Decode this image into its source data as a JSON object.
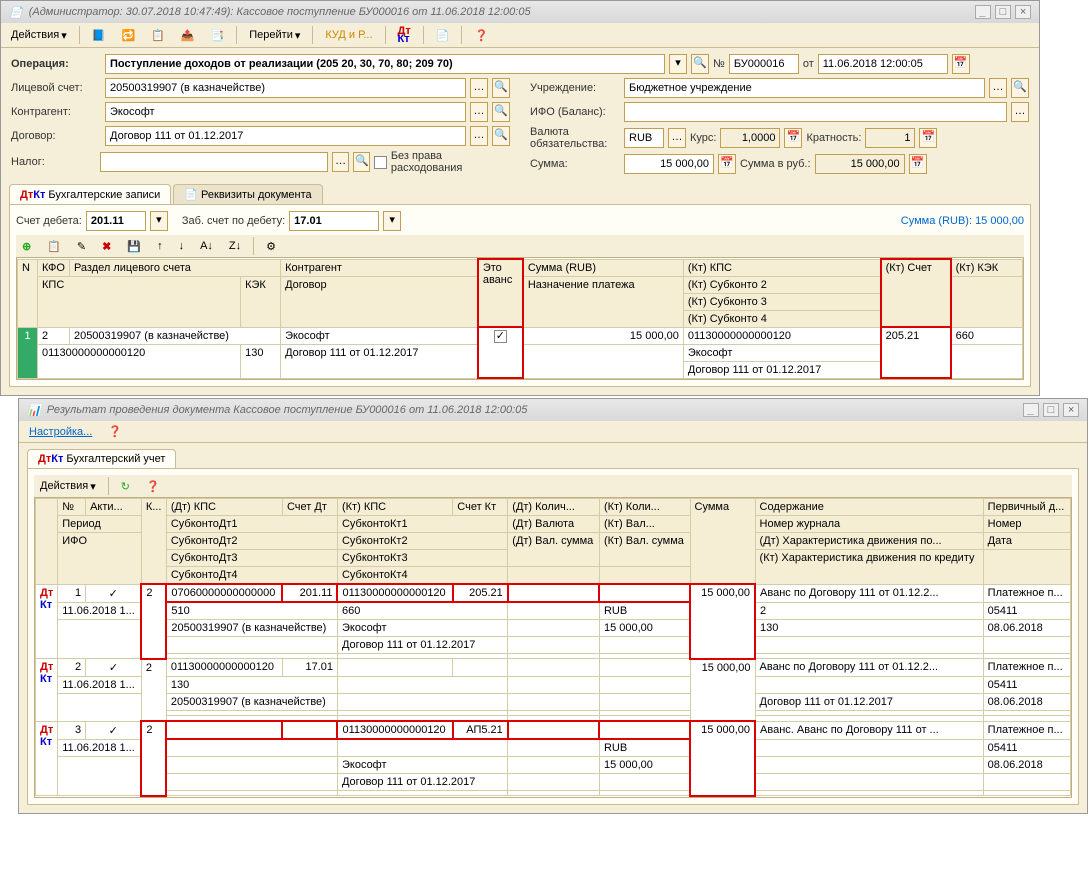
{
  "win1": {
    "title": "(Администратор: 30.07.2018 10:47:49): Кассовое поступление БУ000016 от 11.06.2018 12:00:05",
    "toolbar": {
      "actions": "Действия",
      "goto": "Перейти",
      "kudir": "КУД и Р..."
    },
    "form": {
      "op_label": "Операция:",
      "op_value": "Поступление доходов от реализации (205 20, 30, 70, 80; 209 70)",
      "num_prefix": "№",
      "num": "БУ000016",
      "date_prefix": "от",
      "date": "11.06.2018 12:00:05",
      "ls_label": "Лицевой счет:",
      "ls_value": "20500319907 (в казначействе)",
      "uchr_label": "Учреждение:",
      "uchr_value": "Бюджетное учреждение",
      "kontr_label": "Контрагент:",
      "kontr_value": "Экософт",
      "ifo_label": "ИФО (Баланс):",
      "dog_label": "Договор:",
      "dog_value": "Договор 111 от 01.12.2017",
      "val_label": "Валюта обязательства:",
      "val_value": "RUB",
      "kurs_label": "Курс:",
      "kurs_value": "1,0000",
      "krat_label": "Кратность:",
      "krat_value": "1",
      "nalog_label": "Налог:",
      "bez_prava": "Без права расходования",
      "summa_label": "Сумма:",
      "summa_value": "15 000,00",
      "summa_rub_label": "Сумма в руб.:",
      "summa_rub_value": "15 000,00"
    },
    "tabs": {
      "t1": "Бухгалтерские записи",
      "t2": "Реквизиты документа"
    },
    "grid_top": {
      "schet_debeta_label": "Счет дебета:",
      "schet_debeta": "201.11",
      "zab_label": "Заб. счет по дебету:",
      "zab_value": "17.01",
      "summa_rub_label": "Сумма (RUB): 15 000,00"
    },
    "headers": {
      "n": "N",
      "kfo": "КФО",
      "razdel": "Раздел лицевого счета",
      "kontragent": "Контрагент",
      "eto_avans": "Это аванс",
      "summa": "Сумма (RUB)",
      "kt_kps": "(Кт) КПС",
      "kt_schet": "(Кт) Счет",
      "kt_kek": "(Кт) КЭК",
      "kps": "КПС",
      "kek": "КЭК",
      "dogovor": "Договор",
      "nazn": "Назначение платежа",
      "kt_sub2": "(Кт) Субконто 2",
      "kt_sub3": "(Кт) Субконто 3",
      "kt_sub4": "(Кт) Субконто 4"
    },
    "row": {
      "n": "1",
      "kfo": "2",
      "razdel": "20500319907 (в казначействе)",
      "kontr": "Экософт",
      "avans_check": "✓",
      "summa": "15 000,00",
      "kt_kps": "01130000000000120",
      "kt_schet": "205.21",
      "kt_kek": "660",
      "kps": "01130000000000120",
      "kek": "130",
      "dogovor": "Договор 111 от 01.12.2017",
      "sub2": "Экософт",
      "sub3": "Договор 111 от 01.12.2017"
    }
  },
  "win2": {
    "title": "Результат проведения документа Кассовое поступление БУ000016 от 11.06.2018 12:00:05",
    "settings": "Настройка...",
    "tab1": "Бухгалтерский учет",
    "actions": "Действия",
    "headers": {
      "n": "№",
      "akti": "Акти...",
      "k": "К...",
      "dt_kps": "(Дт) КПС",
      "schet_dt": "Счет Дт",
      "kt_kps": "(Кт) КПС",
      "schet_kt": "Счет Кт",
      "dt_kolich": "(Дт) Колич...",
      "kt_kolich": "(Кт) Коли...",
      "summa": "Сумма",
      "soderzhanie": "Содержание",
      "perv": "Первичный д...",
      "period": "Период",
      "sub_dt1": "СубконтоДт1",
      "sub_kt1": "СубконтоКт1",
      "dt_val": "(Дт) Валюта",
      "kt_val": "(Кт) Вал...",
      "nomer_zh": "Номер журнала",
      "nomer": "Номер",
      "ifo": "ИФО",
      "sub_dt2": "СубконтоДт2",
      "sub_kt2": "СубконтоКт2",
      "dt_val_sum": "(Дт) Вал. сумма",
      "kt_val_sum": "(Кт) Вал. сумма",
      "dt_har": "(Дт) Характеристика движения по...",
      "data": "Дата",
      "sub_dt3": "СубконтоДт3",
      "sub_kt3": "СубконтоКт3",
      "kt_har": "(Кт) Характеристика движения по кредиту",
      "sub_dt4": "СубконтоДт4",
      "sub_kt4": "СубконтоКт4"
    },
    "rows": [
      {
        "n": "1",
        "k": "2",
        "dt_kps": "07060000000000000",
        "schet_dt": "201.11",
        "kt_kps": "01130000000000120",
        "schet_kt": "205.21",
        "summa": "15 000,00",
        "soderzh": "Аванс по Договору 111 от 01.12.2...",
        "perv": "Платежное п...",
        "period": "11.06.2018 1...",
        "sub_dt1": "510",
        "sub_kt1": "660",
        "kt_val": "RUB",
        "nomer_zh": "2",
        "nomer": "05411",
        "sub_dt2": "20500319907 (в казначействе)",
        "sub_kt2": "Экософт",
        "kt_val_sum": "15 000,00",
        "dt_har": "130",
        "data": "08.06.2018",
        "sub_kt3": "Договор 111 от 01.12.2017"
      },
      {
        "n": "2",
        "k": "2",
        "dt_kps": "01130000000000120",
        "schet_dt": "17.01",
        "summa": "15 000,00",
        "soderzh": "Аванс по Договору 111 от 01.12.2...",
        "perv": "Платежное п...",
        "period": "11.06.2018 1...",
        "sub_dt1": "130",
        "nomer": "05411",
        "sub_dt2": "20500319907 (в казначействе)",
        "dt_har": "Договор 111 от 01.12.2017",
        "data": "08.06.2018"
      },
      {
        "n": "3",
        "k": "2",
        "kt_kps": "01130000000000120",
        "schet_kt": "АП5.21",
        "summa": "15 000,00",
        "soderzh": "Аванс. Аванс по Договору 111 от ...",
        "perv": "Платежное п...",
        "period": "11.06.2018 1...",
        "sub_kt2": "Экософт",
        "kt_val": "RUB",
        "nomer": "05411",
        "sub_kt3": "Договор 111 от 01.12.2017",
        "kt_val_sum": "15 000,00",
        "data": "08.06.2018"
      }
    ]
  }
}
